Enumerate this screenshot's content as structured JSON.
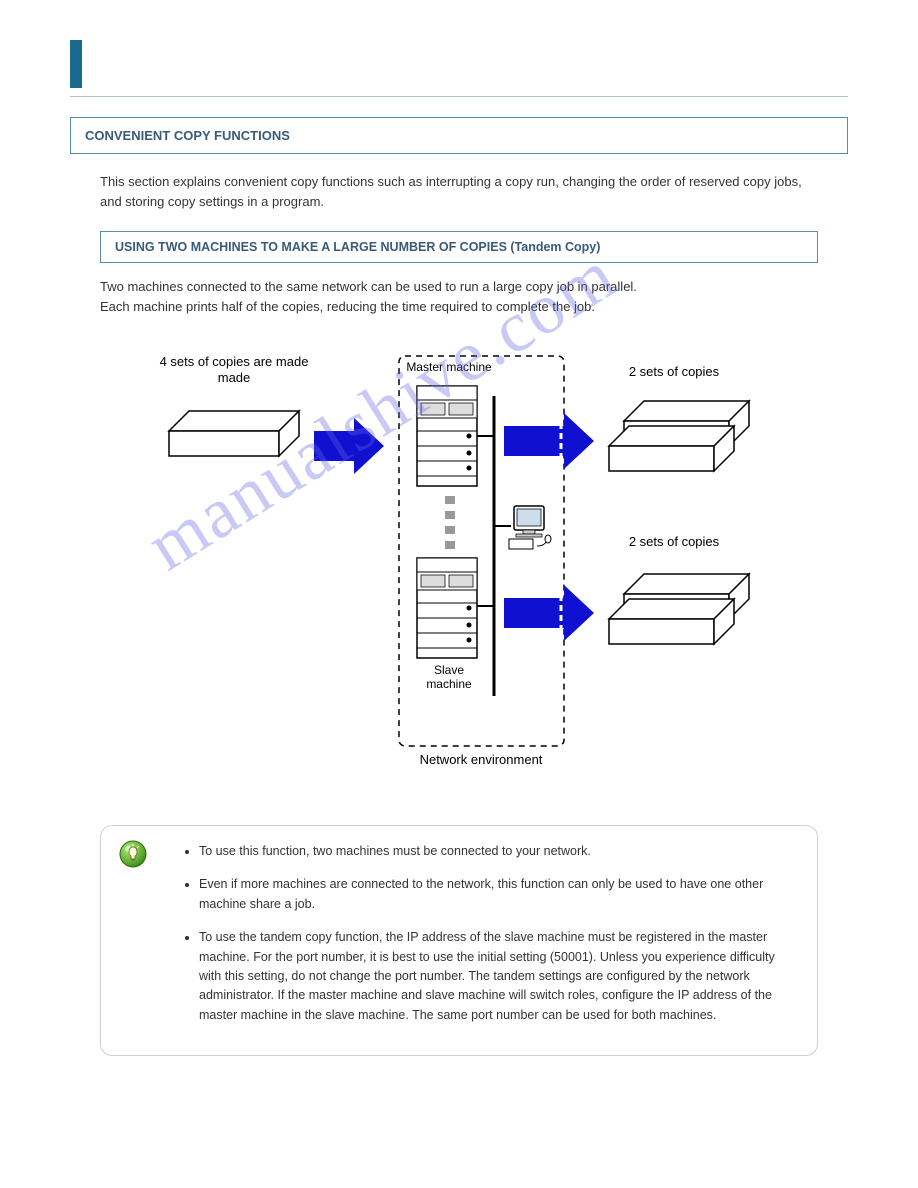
{
  "section_main": "CONVENIENT COPY FUNCTIONS",
  "intro_text": "This section explains convenient copy functions such as interrupting a copy run, changing the order of reserved copy jobs, and storing copy settings in a program.",
  "section_sub": "USING TWO MACHINES TO MAKE A LARGE NUMBER OF COPIES (Tandem Copy)",
  "sub_text": "Two machines connected to the same network can be used to run a large copy job in parallel.\nEach machine prints half of the copies, reducing the time required to complete the job.",
  "diagram": {
    "left_caption": "4 sets of copies are made",
    "master_label": "Master machine",
    "slave_label": "Slave machine",
    "network_label": "Network environment",
    "right_top": "2 sets of copies",
    "right_bottom": "2 sets of copies"
  },
  "tips": [
    "To use this function, two machines must be connected to your network.",
    "Even if more machines are connected to the network, this function can only be used to have one other machine share a job.",
    "To use the tandem copy function, the IP address of the slave machine must be registered in the master machine. For the port number, it is best to use the initial setting (50001). Unless you experience difficulty with this setting, do not change the port number. The tandem settings are configured by the network administrator. If the master machine and slave machine will switch roles, configure the IP address of the master machine in the slave machine. The same port number can be used for both machines."
  ],
  "watermark_text": "manualshive.com"
}
